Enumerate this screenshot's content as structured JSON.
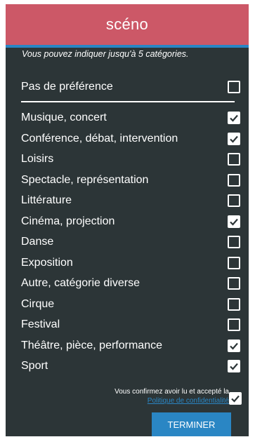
{
  "app": {
    "title": "scéno"
  },
  "hint": "Vous pouvez indiquer jusqu'à 5 catégories.",
  "no_preference": {
    "label": "Pas de préférence",
    "checked": false
  },
  "categories": [
    {
      "label": "Musique, concert",
      "checked": true
    },
    {
      "label": "Conférence, débat, intervention",
      "checked": true
    },
    {
      "label": "Loisirs",
      "checked": false
    },
    {
      "label": "Spectacle, représentation",
      "checked": false
    },
    {
      "label": "Littérature",
      "checked": false
    },
    {
      "label": "Cinéma, projection",
      "checked": true
    },
    {
      "label": "Danse",
      "checked": false
    },
    {
      "label": "Exposition",
      "checked": false
    },
    {
      "label": "Autre, catégorie diverse",
      "checked": false
    },
    {
      "label": "Cirque",
      "checked": false
    },
    {
      "label": "Festival",
      "checked": false
    },
    {
      "label": "Théâtre, pièce, performance",
      "checked": true
    },
    {
      "label": "Sport",
      "checked": true
    }
  ],
  "consent": {
    "text": "Vous confirmez avoir lu et accepté la",
    "link": "Politique de confidentialité",
    "checked": true
  },
  "finish_button": "TERMINER",
  "colors": {
    "header": "#cc5867",
    "background": "#2c3537",
    "accent": "#2a86c4"
  }
}
